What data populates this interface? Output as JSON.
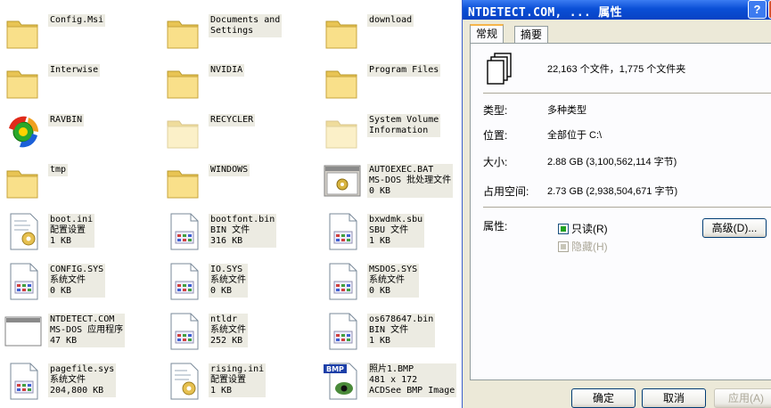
{
  "explorer": {
    "items": [
      {
        "name": "Config.Msi",
        "line2": "",
        "line3": "",
        "icon": "folder-icon"
      },
      {
        "name": "Documents and",
        "line2": "Settings",
        "line3": "",
        "icon": "folder-icon"
      },
      {
        "name": "download",
        "line2": "",
        "line3": "",
        "icon": "folder-icon"
      },
      {
        "name": "Interwise",
        "line2": "",
        "line3": "",
        "icon": "folder-icon"
      },
      {
        "name": "NVIDIA",
        "line2": "",
        "line3": "",
        "icon": "folder-icon"
      },
      {
        "name": "Program Files",
        "line2": "",
        "line3": "",
        "icon": "folder-icon"
      },
      {
        "name": "RAVBIN",
        "line2": "",
        "line3": "",
        "icon": "rising-antivirus-icon"
      },
      {
        "name": "RECYCLER",
        "line2": "",
        "line3": "",
        "icon": "hidden-folder-icon"
      },
      {
        "name": "System Volume",
        "line2": "Information",
        "line3": "",
        "icon": "hidden-folder-icon"
      },
      {
        "name": "tmp",
        "line2": "",
        "line3": "",
        "icon": "folder-icon"
      },
      {
        "name": "WINDOWS",
        "line2": "",
        "line3": "",
        "icon": "folder-icon"
      },
      {
        "name": "AUTOEXEC.BAT",
        "line2": "MS-DOS 批处理文件",
        "line3": "0 KB",
        "icon": "batch-file-icon"
      },
      {
        "name": "boot.ini",
        "line2": "配置设置",
        "line3": "1 KB",
        "icon": "ini-file-icon"
      },
      {
        "name": "bootfont.bin",
        "line2": "BIN 文件",
        "line3": "316 KB",
        "icon": "system-file-icon"
      },
      {
        "name": "bxwdmk.sbu",
        "line2": "SBU 文件",
        "line3": "1 KB",
        "icon": "system-file-icon"
      },
      {
        "name": "CONFIG.SYS",
        "line2": "系统文件",
        "line3": "0 KB",
        "icon": "system-file-icon"
      },
      {
        "name": "IO.SYS",
        "line2": "系统文件",
        "line3": "0 KB",
        "icon": "system-file-icon"
      },
      {
        "name": "MSDOS.SYS",
        "line2": "系统文件",
        "line3": "0 KB",
        "icon": "system-file-icon"
      },
      {
        "name": "NTDETECT.COM",
        "line2": "MS-DOS 应用程序",
        "line3": "47 KB",
        "icon": "application-icon"
      },
      {
        "name": "ntldr",
        "line2": "系统文件",
        "line3": "252 KB",
        "icon": "system-file-icon"
      },
      {
        "name": "os678647.bin",
        "line2": "BIN 文件",
        "line3": "1 KB",
        "icon": "system-file-icon"
      },
      {
        "name": "pagefile.sys",
        "line2": "系统文件",
        "line3": "204,800 KB",
        "icon": "system-file-icon"
      },
      {
        "name": "rising.ini",
        "line2": "配置设置",
        "line3": "1 KB",
        "icon": "ini-file-icon"
      },
      {
        "name": "照片1.BMP",
        "line2": "481 x 172",
        "line3": "ACDSee BMP Image",
        "icon": "bmp-image-icon"
      }
    ]
  },
  "dialog": {
    "title": "NTDETECT.COM, ... 属性",
    "help_label": "?",
    "tabs": [
      {
        "label": "常规"
      },
      {
        "label": "摘要"
      }
    ],
    "summary": "22,163 个文件，1,775 个文件夹",
    "props": {
      "type_label": "类型:",
      "type_value": "多种类型",
      "location_label": "位置:",
      "location_value": "全部位于 C:\\",
      "size_label": "大小:",
      "size_value": "2.88 GB (3,100,562,114 字节)",
      "disk_label": "占用空间:",
      "disk_value": "2.73 GB (2,938,504,671 字节)",
      "attr_label": "属性:"
    },
    "attributes": {
      "readonly_label": "只读(R)",
      "readonly_checked": true,
      "hidden_label": "隐藏(H)",
      "hidden_checked": false
    },
    "advanced_button": "高级(D)...",
    "buttons": {
      "ok": "确定",
      "cancel": "取消",
      "apply": "应用(A)"
    }
  }
}
